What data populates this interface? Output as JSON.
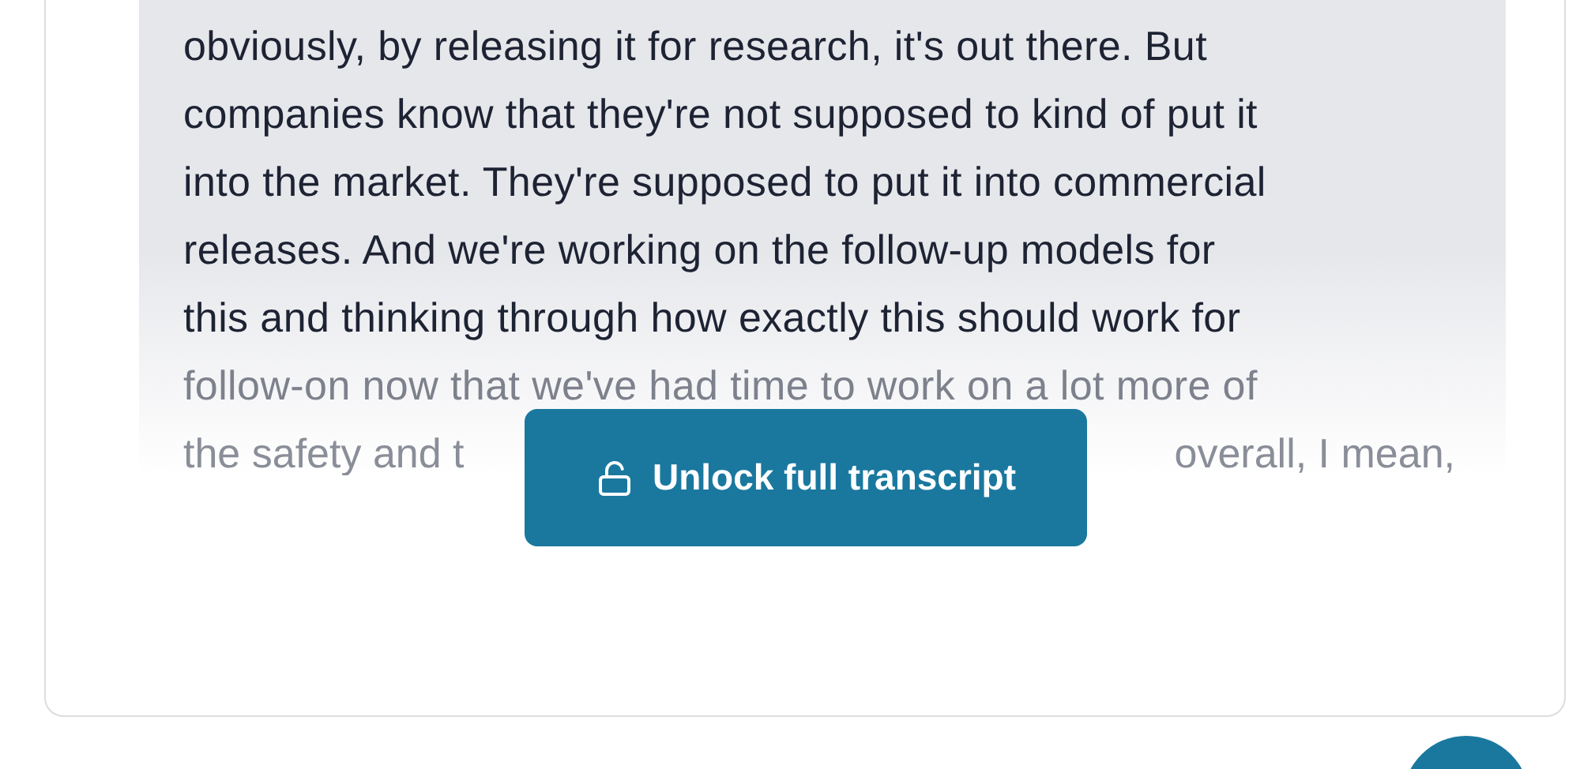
{
  "transcript": {
    "lines": [
      "obviously, by releasing it for research, it's out there. But",
      "companies know that they're not supposed to kind of put it",
      "into the market. They're supposed to put it into commercial",
      "releases. And we're working on the follow-up models for",
      "this and thinking through how exactly this should work for",
      "follow-on now that we've had time to work on a lot more of"
    ],
    "last_line_start": "the safety and t",
    "last_line_end": "overall, I mean,"
  },
  "unlock_button": {
    "label": "Unlock full transcript"
  }
}
